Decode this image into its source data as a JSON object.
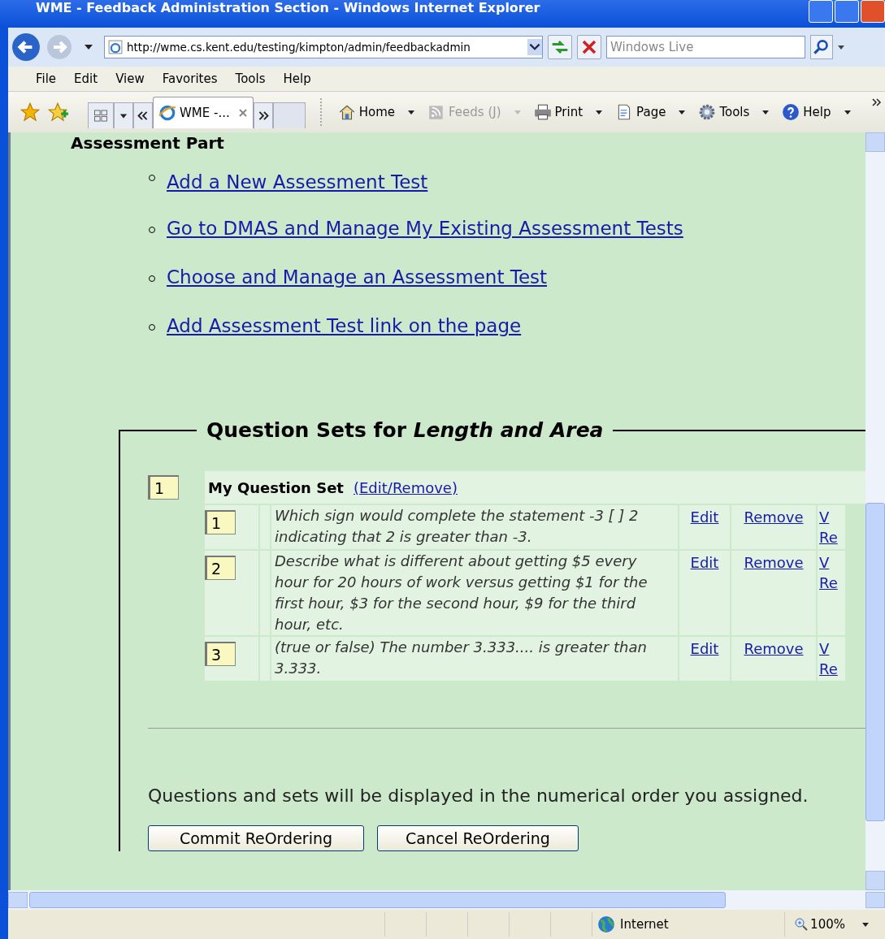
{
  "window": {
    "title": "WME - Feedback Administration Section - Windows Internet Explorer"
  },
  "address_bar": {
    "value": "http://wme.cs.kent.edu/testing/kimpton/admin/feedbackadmin",
    "search_placeholder": "Windows Live"
  },
  "menu": [
    "File",
    "Edit",
    "View",
    "Favorites",
    "Tools",
    "Help"
  ],
  "tabs": [
    {
      "label": "WME -...",
      "selected": true
    }
  ],
  "command_bar": [
    {
      "label": "Home",
      "disabled": false
    },
    {
      "label": "Feeds (J)",
      "disabled": true
    },
    {
      "label": "Print",
      "disabled": false
    },
    {
      "label": "Page",
      "disabled": false
    },
    {
      "label": "Tools",
      "disabled": false
    },
    {
      "label": "Help",
      "disabled": false
    }
  ],
  "page": {
    "heading": "Assessment Part",
    "links": [
      "Add a New Assessment Test",
      "Go to DMAS and Manage My Existing Assessment Tests",
      "Choose and Manage an Assessment Test",
      "Add Assessment Test link on the page"
    ],
    "legend": "Question Sets for *Length and Area*",
    "set": {
      "order": "1",
      "name": "My Question Set",
      "action": "(Edit/Remove)"
    },
    "questions": [
      {
        "order": "1",
        "text": "Which sign would complete the statement -3 [ ] 2 indicating that 2 is greater than -3.",
        "edit": "Edit",
        "remove": "Remove",
        "column_5": [
          "V",
          "Re"
        ]
      },
      {
        "order": "2",
        "text": "Describe what is different about getting $5 every hour for 20 hours of work versus getting $1 for the first hour, $3 for the second hour, $9 for the third hour, etc.",
        "edit": "Edit",
        "remove": "Remove",
        "column_5": [
          "V",
          "Re"
        ]
      },
      {
        "order": "3",
        "text": "(true or false) The number 3.333.... is greater than 3.333.",
        "edit": "Edit",
        "remove": "Remove",
        "column_5": [
          "V",
          "Re"
        ]
      }
    ],
    "note": "Questions and sets will be displayed in the numerical order you assigned.",
    "buttons": [
      "Commit ReOrdering",
      "Cancel ReOrdering"
    ]
  },
  "status_bar": {
    "zone": "Internet",
    "zoom": "100%"
  }
}
